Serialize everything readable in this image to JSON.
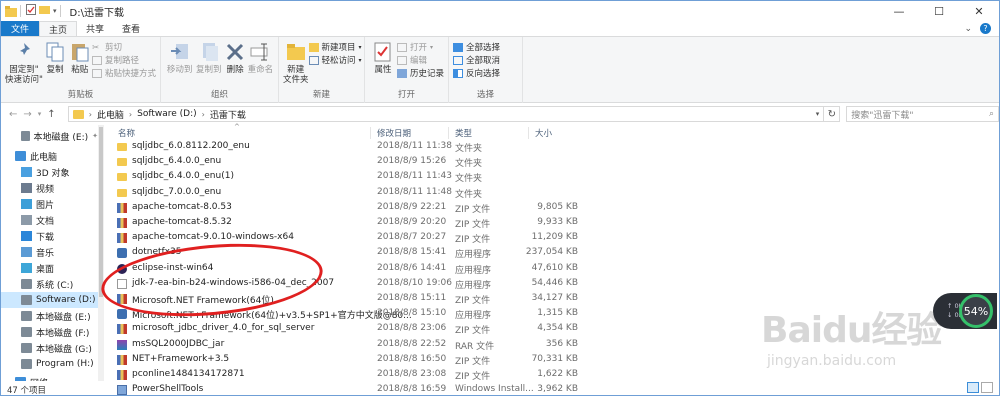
{
  "window": {
    "title": "D:\\迅雷下载",
    "minimize": "—",
    "maximize": "☐",
    "close": "✕"
  },
  "tabs": {
    "file": "文件",
    "home": "主页",
    "share": "共享",
    "view": "查看"
  },
  "ribbon": {
    "clipboard": {
      "label": "剪贴板",
      "pin": "固定到\"\n快速访问\"",
      "copy": "复制",
      "paste": "粘贴",
      "cut": "剪切",
      "copy_path": "复制路径",
      "paste_shortcut": "粘贴快捷方式"
    },
    "organize": {
      "label": "组织",
      "move_to": "移动到",
      "copy_to": "复制到",
      "delete": "删除",
      "rename": "重命名"
    },
    "new": {
      "label": "新建",
      "new_folder": "新建\n文件夹",
      "new_item": "新建项目",
      "easy_access": "轻松访问"
    },
    "open": {
      "label": "打开",
      "properties": "属性",
      "open": "打开",
      "edit": "编辑",
      "history": "历史记录"
    },
    "select": {
      "label": "选择",
      "select_all": "全部选择",
      "select_none": "全部取消",
      "invert": "反向选择"
    }
  },
  "address": {
    "crumbs": [
      "此电脑",
      "Software (D:)",
      "迅雷下载"
    ],
    "search_placeholder": "搜索\"迅雷下载\""
  },
  "nav_pane": [
    {
      "label": "本地磁盘 (E:)",
      "icon": "drive-icon",
      "cls": "drv",
      "indent": 20
    },
    {
      "label": "此电脑",
      "icon": "pc-icon",
      "cls": "pc",
      "indent": 14
    },
    {
      "label": "3D 对象",
      "icon": "3d-objects-icon",
      "cls": "f3d",
      "indent": 20
    },
    {
      "label": "视频",
      "icon": "videos-icon",
      "cls": "fv",
      "indent": 20
    },
    {
      "label": "图片",
      "icon": "pictures-icon",
      "cls": "fp",
      "indent": 20
    },
    {
      "label": "文档",
      "icon": "documents-icon",
      "cls": "fd",
      "indent": 20
    },
    {
      "label": "下载",
      "icon": "downloads-icon",
      "cls": "fdown",
      "indent": 20
    },
    {
      "label": "音乐",
      "icon": "music-icon",
      "cls": "fm",
      "indent": 20
    },
    {
      "label": "桌面",
      "icon": "desktop-icon",
      "cls": "fdesk",
      "indent": 20
    },
    {
      "label": "系统 (C:)",
      "icon": "drive-icon",
      "cls": "drv",
      "indent": 20
    },
    {
      "label": "Software (D:)",
      "icon": "drive-icon",
      "cls": "drv",
      "indent": 20
    },
    {
      "label": "本地磁盘 (E:)",
      "icon": "drive-icon",
      "cls": "drv",
      "indent": 20
    },
    {
      "label": "本地磁盘 (F:)",
      "icon": "drive-icon",
      "cls": "drv",
      "indent": 20
    },
    {
      "label": "本地磁盘 (G:)",
      "icon": "drive-icon",
      "cls": "drv",
      "indent": 20
    },
    {
      "label": "Program (H:)",
      "icon": "drive-icon",
      "cls": "drv",
      "indent": 20
    },
    {
      "label": "网络",
      "icon": "network-icon",
      "cls": "pc",
      "indent": 14
    }
  ],
  "columns": {
    "name": "名称",
    "date": "修改日期",
    "type": "类型",
    "size": "大小"
  },
  "files": [
    {
      "name": "sqljdbc_6.0.8112.200_enu",
      "date": "2018/8/11 11:38",
      "type": "文件夹",
      "size": "",
      "icon": "folder"
    },
    {
      "name": "sqljdbc_6.4.0.0_enu",
      "date": "2018/8/9 15:26",
      "type": "文件夹",
      "size": "",
      "icon": "folder"
    },
    {
      "name": "sqljdbc_6.4.0.0_enu(1)",
      "date": "2018/8/11 11:43",
      "type": "文件夹",
      "size": "",
      "icon": "folder"
    },
    {
      "name": "sqljdbc_7.0.0.0_enu",
      "date": "2018/8/11 11:48",
      "type": "文件夹",
      "size": "",
      "icon": "folder"
    },
    {
      "name": "apache-tomcat-8.0.53",
      "date": "2018/8/9 22:21",
      "type": "ZIP 文件",
      "size": "9,805 KB",
      "icon": "zip"
    },
    {
      "name": "apache-tomcat-8.5.32",
      "date": "2018/8/9 20:20",
      "type": "ZIP 文件",
      "size": "9,933 KB",
      "icon": "zip"
    },
    {
      "name": "apache-tomcat-9.0.10-windows-x64",
      "date": "2018/8/7 20:27",
      "type": "ZIP 文件",
      "size": "11,209 KB",
      "icon": "zip"
    },
    {
      "name": "dotnetfx35",
      "date": "2018/8/8 15:41",
      "type": "应用程序",
      "size": "237,054 KB",
      "icon": "exe"
    },
    {
      "name": "eclipse-inst-win64",
      "date": "2018/8/6 14:41",
      "type": "应用程序",
      "size": "47,610 KB",
      "icon": "ecl"
    },
    {
      "name": "jdk-7-ea-bin-b24-windows-i586-04_dec_2007",
      "date": "2018/8/10 19:06",
      "type": "应用程序",
      "size": "54,446 KB",
      "icon": "jdk"
    },
    {
      "name": "Microsoft.NET Framework(64位)",
      "date": "2018/8/8 15:11",
      "type": "ZIP 文件",
      "size": "34,127 KB",
      "icon": "zip"
    },
    {
      "name": "Microsoft.NET+Framework(64位)+v3.5+SP1+官方中文版@80...",
      "date": "2018/8/8 15:10",
      "type": "应用程序",
      "size": "1,315 KB",
      "icon": "exe"
    },
    {
      "name": "microsoft_jdbc_driver_4.0_for_sql_server",
      "date": "2018/8/8 23:06",
      "type": "ZIP 文件",
      "size": "4,354 KB",
      "icon": "zip"
    },
    {
      "name": "msSQL2000JDBC_jar",
      "date": "2018/8/8 22:52",
      "type": "RAR 文件",
      "size": "356 KB",
      "icon": "rar"
    },
    {
      "name": "NET+Framework+3.5",
      "date": "2018/8/8 16:50",
      "type": "ZIP 文件",
      "size": "70,331 KB",
      "icon": "zip"
    },
    {
      "name": "pconline1484134172871",
      "date": "2018/8/8 23:08",
      "type": "ZIP 文件",
      "size": "1,622 KB",
      "icon": "zip"
    },
    {
      "name": "PowerShellTools",
      "date": "2018/8/8 16:59",
      "type": "Windows Install...",
      "size": "3,962 KB",
      "icon": "msi"
    }
  ],
  "status": {
    "count": "47 个项目"
  },
  "overlay": {
    "watermark_big": "Baidu经验",
    "watermark_small": "jingyan.baidu.com",
    "net_up": "0K/s",
    "net_down": "0K/s",
    "gauge": "54%"
  }
}
